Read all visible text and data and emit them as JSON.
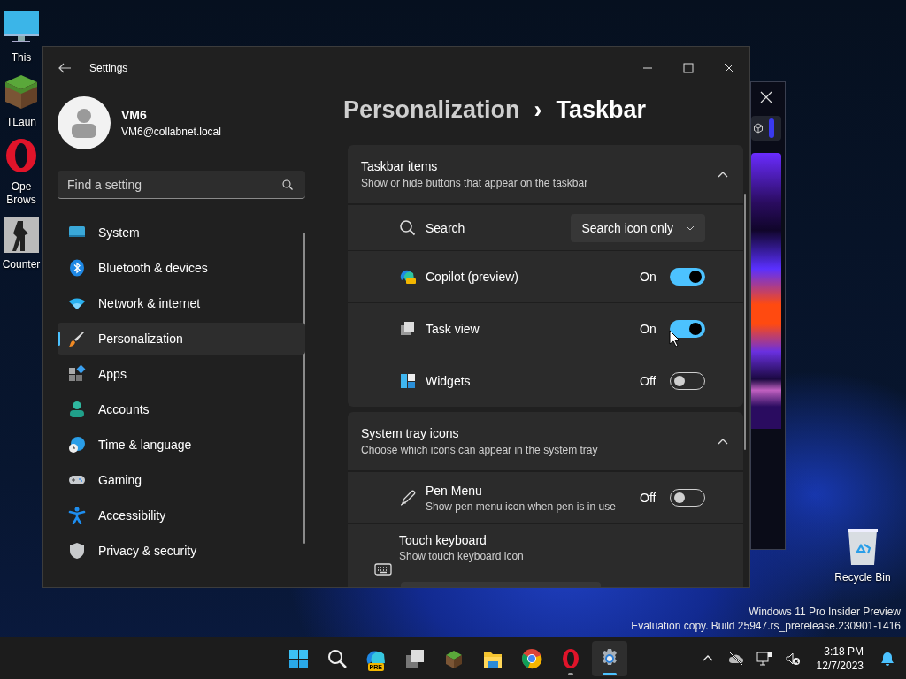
{
  "desktop_icons": [
    {
      "kind": "monitor",
      "lines": [
        "This"
      ]
    },
    {
      "kind": "grass-block",
      "lines": [
        "TLaun"
      ]
    },
    {
      "kind": "opera",
      "lines": [
        "Ope",
        "Brows"
      ]
    },
    {
      "kind": "game",
      "lines": [
        "Counter"
      ]
    }
  ],
  "settings_window": {
    "title": "Settings",
    "account": {
      "name": "VM6",
      "email": "VM6@collabnet.local"
    },
    "search": {
      "placeholder": "Find a setting"
    },
    "nav_items": [
      {
        "kind": "system",
        "label": "System",
        "selected": false
      },
      {
        "kind": "bluetooth",
        "label": "Bluetooth & devices",
        "selected": false
      },
      {
        "kind": "network",
        "label": "Network & internet",
        "selected": false
      },
      {
        "kind": "personalization",
        "label": "Personalization",
        "selected": true
      },
      {
        "kind": "apps",
        "label": "Apps",
        "selected": false
      },
      {
        "kind": "accounts",
        "label": "Accounts",
        "selected": false
      },
      {
        "kind": "time",
        "label": "Time & language",
        "selected": false
      },
      {
        "kind": "gaming",
        "label": "Gaming",
        "selected": false
      },
      {
        "kind": "accessibility",
        "label": "Accessibility",
        "selected": false
      },
      {
        "kind": "privacy",
        "label": "Privacy & security",
        "selected": false
      }
    ],
    "breadcrumb": {
      "parent": "Personalization",
      "separator": "›",
      "current": "Taskbar"
    },
    "sections": [
      {
        "title": "Taskbar items",
        "subtitle": "Show or hide buttons that appear on the taskbar",
        "expanded": true,
        "rows": [
          {
            "kind": "dropdown",
            "label": "Search",
            "value": "Search icon only"
          },
          {
            "kind": "toggle",
            "label": "Copilot (preview)",
            "state_text": "On",
            "on": true
          },
          {
            "kind": "toggle",
            "label": "Task view",
            "state_text": "On",
            "on": true
          },
          {
            "kind": "toggle",
            "label": "Widgets",
            "state_text": "Off",
            "on": false
          }
        ]
      },
      {
        "title": "System tray icons",
        "subtitle": "Choose which icons can appear in the system tray",
        "expanded": true,
        "rows": [
          {
            "kind": "toggle",
            "label": "Pen Menu",
            "description": "Show pen menu icon when pen is in use",
            "state_text": "Off",
            "on": false
          },
          {
            "kind": "select-below",
            "label": "Touch keyboard",
            "description": "Show touch keyboard icon"
          }
        ]
      }
    ]
  },
  "recycle_bin": {
    "label": "Recycle Bin"
  },
  "os_build_notice": [
    "Windows 11 Pro Insider Preview",
    "Evaluation copy. Build 25947.rs_prerelease.230901-1416"
  ],
  "taskbar": {
    "apps": [
      {
        "kind": "start",
        "selected": false,
        "running": false
      },
      {
        "kind": "search",
        "selected": false,
        "running": false
      },
      {
        "kind": "copilot",
        "badge": "PRE",
        "selected": false,
        "running": false
      },
      {
        "kind": "taskview",
        "selected": false,
        "running": false
      },
      {
        "kind": "minecraft",
        "selected": false,
        "running": false
      },
      {
        "kind": "explorer",
        "selected": false,
        "running": false
      },
      {
        "kind": "chrome",
        "selected": false,
        "running": false
      },
      {
        "kind": "opera",
        "selected": false,
        "running": true
      },
      {
        "kind": "settings",
        "selected": true,
        "running": true
      }
    ],
    "clock": {
      "time": "3:18 PM",
      "date": "12/7/2023"
    }
  }
}
